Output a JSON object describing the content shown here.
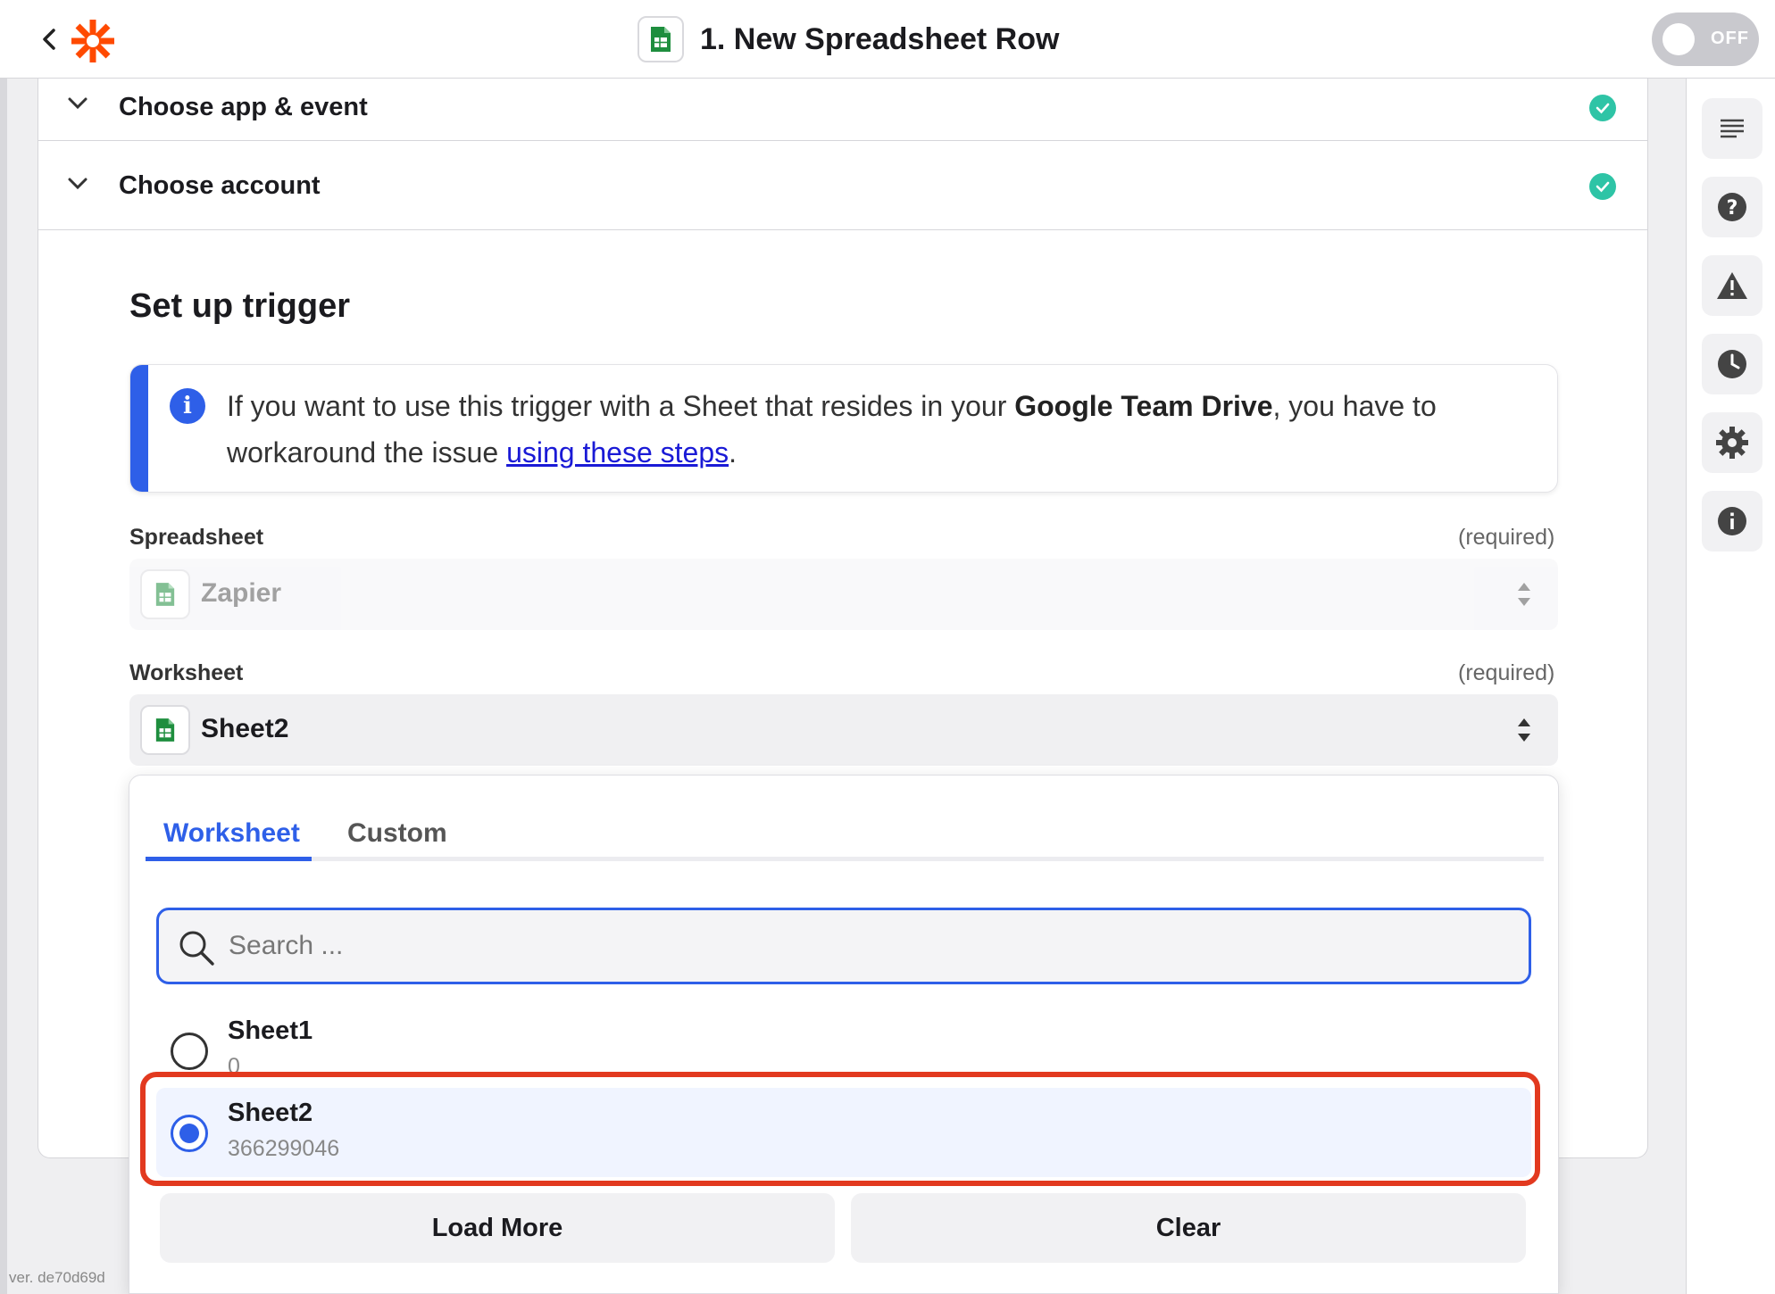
{
  "header": {
    "back_label": "‹",
    "title": "1. New Spreadsheet Row",
    "toggle_label": "OFF",
    "brand_color": "#ff4a00"
  },
  "sections": [
    {
      "label": "Choose app & event",
      "status": "complete"
    },
    {
      "label": "Choose account",
      "status": "complete"
    }
  ],
  "setup": {
    "title": "Set up trigger",
    "info": {
      "text_before": "If you want to use this trigger with a Sheet that resides in your ",
      "bold": "Google Team Drive",
      "text_middle": ", you have to workaround the issue ",
      "link": "using these steps",
      "text_after": "."
    },
    "spreadsheet": {
      "label": "Spreadsheet",
      "required": "(required)",
      "value": "Zapier"
    },
    "worksheet": {
      "label": "Worksheet",
      "required": "(required)",
      "value": "Sheet2"
    }
  },
  "dropdown": {
    "tabs": [
      {
        "label": "Worksheet",
        "active": true
      },
      {
        "label": "Custom",
        "active": false
      }
    ],
    "search_placeholder": "Search ...",
    "options": [
      {
        "name": "Sheet1",
        "id": "0",
        "selected": false
      },
      {
        "name": "Sheet2",
        "id": "366299046",
        "selected": true
      }
    ],
    "load_more_label": "Load More",
    "clear_label": "Clear"
  },
  "sidebar_icons": [
    "details-icon",
    "help-icon",
    "warning-icon",
    "history-icon",
    "settings-icon",
    "info-icon"
  ],
  "version": "ver. de70d69d",
  "colors": {
    "accent": "#2e5fe8",
    "success": "#2ec4a6",
    "highlight": "#e2391f",
    "sheets_green": "#1e8e3e"
  }
}
